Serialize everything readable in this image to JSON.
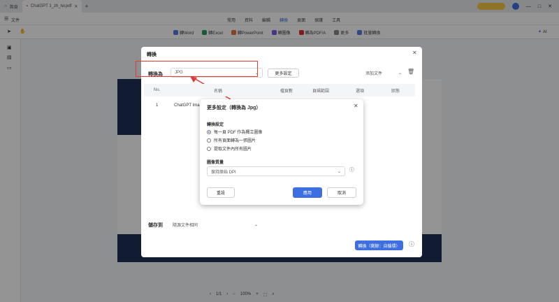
{
  "tabs": [
    {
      "label": "首頁"
    },
    {
      "label": "ChatGPT 1_zh_tw.pdf"
    }
  ],
  "menu": [
    "常用",
    "資料",
    "編輯",
    "轉換",
    "頁面",
    "保護",
    "工具"
  ],
  "toolbar_items": [
    "轉Word",
    "轉Excel",
    "轉PowerPoint",
    "轉圖像",
    "轉為PDF/A",
    "更多",
    "批量轉換"
  ],
  "file_label": "文件",
  "ai_label": "AI",
  "panel": {
    "title": "轉換",
    "convert_to_label": "轉換為",
    "format_value": "JPG",
    "more_settings": "更多設定",
    "add_files": "添加文件",
    "columns": [
      "No.",
      "名稱",
      "檔頁數",
      "頁碼範圍",
      "選項",
      "狀態"
    ],
    "row": {
      "no": "1",
      "name": "ChatGPT Ima"
    },
    "save_to_label": "儲存到",
    "save_to_value": "隨源文件相同",
    "convert_button": "轉換（剩餘：自循環）"
  },
  "dialog": {
    "title": "更多設定（轉換為 Jpg）",
    "section1": "轉換設定",
    "options": [
      "每一頁 PDF 作為獨立圖像",
      "所有頁面轉為一張圖片",
      "提取文件內所有圖片"
    ],
    "selected_index": 0,
    "section2": "圖像質量",
    "quality_value": "保持原始 DPI",
    "reset": "重設",
    "apply": "應用",
    "cancel": "取消"
  },
  "pagebar": {
    "page": "1/1",
    "zoom": "100%"
  }
}
